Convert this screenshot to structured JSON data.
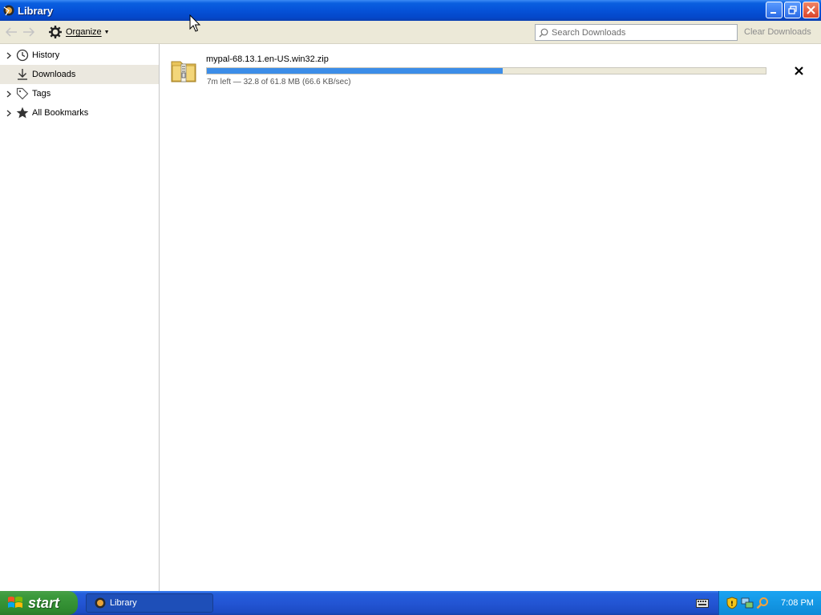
{
  "window": {
    "title": "Library"
  },
  "toolbar": {
    "organize_label": "Organize",
    "search_placeholder": "Search Downloads",
    "clear_label": "Clear Downloads"
  },
  "sidebar": {
    "items": [
      {
        "label": "History",
        "icon": "clock-icon",
        "expandable": true
      },
      {
        "label": "Downloads",
        "icon": "download-icon",
        "expandable": false,
        "selected": true
      },
      {
        "label": "Tags",
        "icon": "tag-icon",
        "expandable": true
      },
      {
        "label": "All Bookmarks",
        "icon": "star-icon",
        "expandable": true
      }
    ]
  },
  "downloads": [
    {
      "filename": "mypal-68.13.1.en-US.win32.zip",
      "status": "7m left — 32.8 of 61.8 MB (66.6 KB/sec)",
      "progress_fraction": 0.53
    }
  ],
  "taskbar": {
    "start_label": "start",
    "task_label": "Library",
    "clock": "7:08 PM"
  },
  "colors": {
    "titlebar": "#0552d8",
    "progress_fill": "#3c8de8",
    "taskbar": "#245edb",
    "start": "#3c9a3c",
    "tray": "#1aa4f2"
  }
}
